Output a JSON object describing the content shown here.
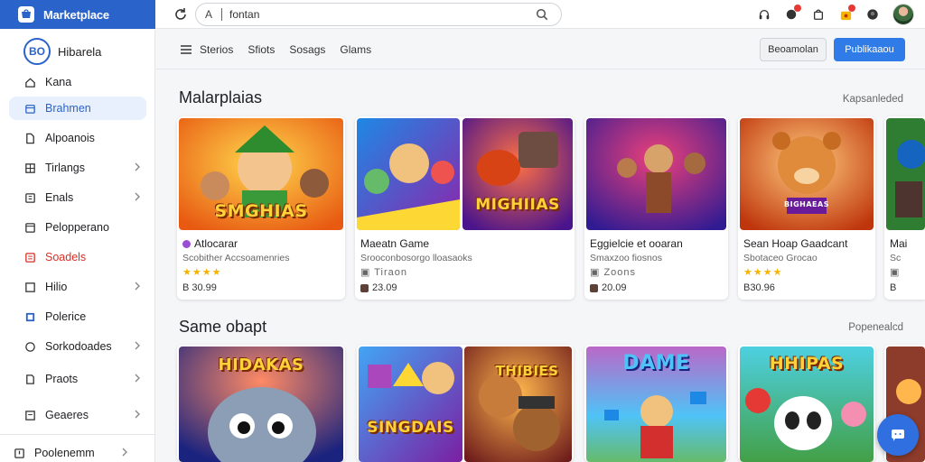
{
  "app": {
    "title": "Marketplace"
  },
  "search": {
    "prefix": "A",
    "value": "fontan"
  },
  "sidebar": {
    "profile": {
      "initials": "BO",
      "name": "Hibarela"
    },
    "items": [
      {
        "label": "Kana",
        "icon": "home-icon"
      },
      {
        "label": "Brahmen",
        "icon": "calendar-icon",
        "active": true
      },
      {
        "label": "Alpoanois",
        "icon": "file-icon"
      },
      {
        "label": "Tirlangs",
        "icon": "grid-icon",
        "chevron": true
      },
      {
        "label": "Enals",
        "icon": "mail-icon",
        "chevron": true
      },
      {
        "label": "Pelopperano",
        "icon": "card-icon"
      },
      {
        "label": "Soadels",
        "icon": "list-icon",
        "accent": true
      },
      {
        "label": "Hilio",
        "icon": "box-icon",
        "chevron": true
      },
      {
        "label": "Polerice",
        "icon": "doc-icon"
      },
      {
        "label": "Sorkodoades",
        "icon": "circle-icon",
        "chevron": true
      },
      {
        "label": "Praots",
        "icon": "tag-icon",
        "chevron": true
      },
      {
        "label": "Geaeres",
        "icon": "page-icon",
        "chevron": true
      }
    ],
    "footer": {
      "label": "Poolenemm",
      "icon": "exit-icon"
    }
  },
  "subbar": {
    "tabs": [
      "Sterios",
      "Sfiots",
      "Sosags",
      "Glams"
    ],
    "secondary_button": "Beoamolan",
    "primary_button": "Publikaaou"
  },
  "sections": [
    {
      "title": "Malarplaias",
      "link": "Kapsanleded",
      "cards": [
        {
          "image_text": "SMGHIAS",
          "title": "Atlocarar",
          "subtitle": "Scobither Accsoamenries",
          "stars": "★★★★",
          "price": "B 30.99"
        },
        {
          "image_text": "MIGHIIAS",
          "title": "Maeatn Game",
          "subtitle": "Srooconbosorgo lloasaoks",
          "stars": "",
          "price": "23.09"
        },
        {
          "image_text": "",
          "title": "Eggielcie et ooaran",
          "subtitle": "Smaxzoo fiosnos",
          "stars": "",
          "price": "20.09"
        },
        {
          "image_text": "BIGHAEAS",
          "title": "Sean Hoap Gaadcant",
          "subtitle": "Sbotaceo Grocao",
          "stars": "★★★★",
          "price": "B30.96"
        },
        {
          "image_text": "",
          "title": "Mai",
          "subtitle": "Sc",
          "stars": "",
          "price": "B"
        }
      ]
    },
    {
      "title": "Same obapt",
      "link": "Popenealcd",
      "cards": [
        {
          "image_text": "HIDAKAS"
        },
        {
          "image_text": "SINGDAIS"
        },
        {
          "image_text": "THIBIES"
        },
        {
          "image_text": "DAME"
        },
        {
          "image_text": "HHIPAS"
        },
        {
          "image_text": ""
        }
      ]
    }
  ],
  "colors": {
    "brand": "#2a63c9",
    "primary_button": "#2f7be8",
    "accent": "#d93025",
    "stars": "#f4b400"
  }
}
